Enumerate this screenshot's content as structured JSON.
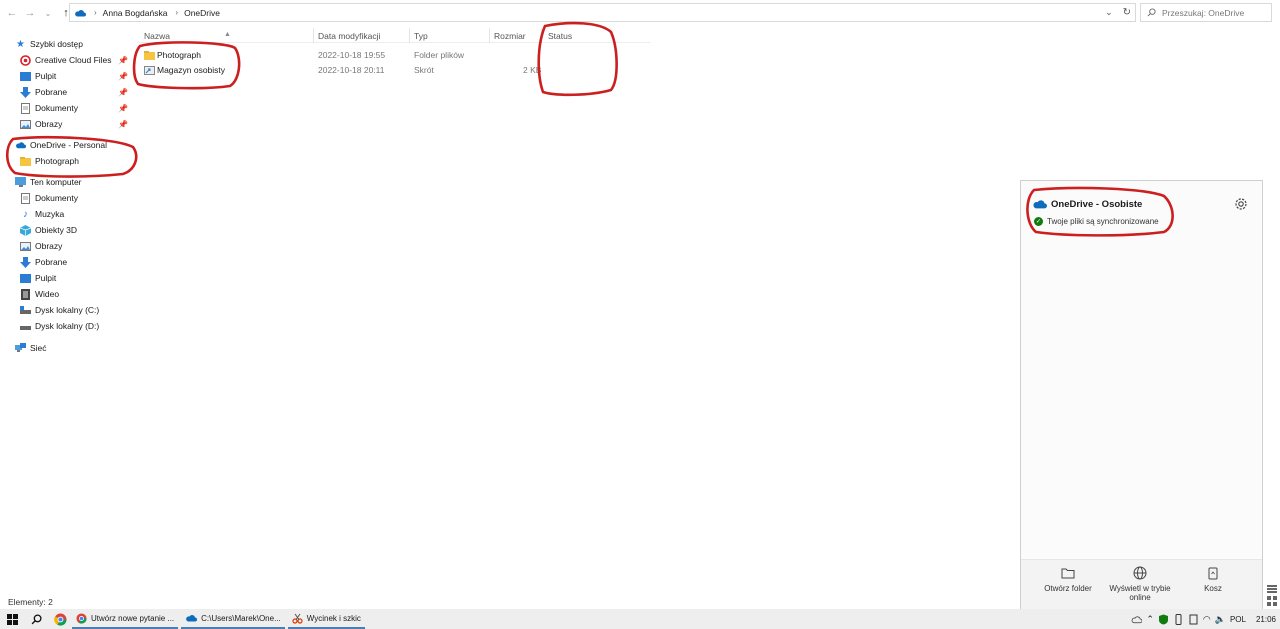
{
  "address_bar": {
    "breadcrumbs": [
      "Anna Bogdańska",
      "OneDrive"
    ]
  },
  "search": {
    "placeholder": "Przeszukaj: OneDrive"
  },
  "nav_pane": {
    "quick_access": {
      "label": "Szybki dostęp",
      "items": [
        {
          "label": "Creative Cloud Files",
          "icon": "creative-cloud-icon",
          "pinned": true
        },
        {
          "label": "Pulpit",
          "icon": "desktop-icon",
          "pinned": true
        },
        {
          "label": "Pobrane",
          "icon": "download-icon",
          "pinned": true
        },
        {
          "label": "Dokumenty",
          "icon": "document-icon",
          "pinned": true
        },
        {
          "label": "Obrazy",
          "icon": "pictures-icon",
          "pinned": true
        }
      ]
    },
    "onedrive": {
      "label": "OneDrive - Personal",
      "items": [
        {
          "label": "Photograph",
          "icon": "folder-icon"
        }
      ]
    },
    "this_pc": {
      "label": "Ten komputer",
      "items": [
        {
          "label": "Dokumenty",
          "icon": "document-icon"
        },
        {
          "label": "Muzyka",
          "icon": "music-icon"
        },
        {
          "label": "Obiekty 3D",
          "icon": "objects-3d-icon"
        },
        {
          "label": "Obrazy",
          "icon": "pictures-icon"
        },
        {
          "label": "Pobrane",
          "icon": "download-icon"
        },
        {
          "label": "Pulpit",
          "icon": "desktop-icon"
        },
        {
          "label": "Wideo",
          "icon": "video-icon"
        },
        {
          "label": "Dysk lokalny (C:)",
          "icon": "drive-icon"
        },
        {
          "label": "Dysk lokalny (D:)",
          "icon": "drive-icon"
        }
      ]
    },
    "network": {
      "label": "Sieć"
    }
  },
  "file_list": {
    "columns": [
      "Nazwa",
      "Data modyfikacji",
      "Typ",
      "Rozmiar",
      "Status"
    ],
    "rows": [
      {
        "name": "Photograph",
        "modified": "2022-10-18 19:55",
        "type": "Folder plików",
        "size": ""
      },
      {
        "name": "Magazyn osobisty",
        "modified": "2022-10-18 20:11",
        "type": "Skrót",
        "size": "2 KB"
      }
    ]
  },
  "status_bar": {
    "text": "Elementy: 2"
  },
  "onedrive_flyout": {
    "title": "OneDrive - Osobiste",
    "status": "Twoje pliki są synchronizowane",
    "footer": {
      "open_folder": "Otwórz folder",
      "view_online": "Wyświetl w trybie online",
      "recycle_bin": "Kosz"
    }
  },
  "taskbar": {
    "apps": [
      {
        "label": "Utwórz nowe pytanie ...",
        "icon": "chrome-icon"
      },
      {
        "label": "C:\\Users\\Marek\\One...",
        "icon": "onedrive-icon"
      },
      {
        "label": "Wycinek i szkic",
        "icon": "snip-sketch-icon"
      }
    ],
    "tray": {
      "language": "POL",
      "time": "21:06"
    }
  },
  "colors": {
    "annotation": "#cc1f1f",
    "onedrive_blue": "#0f6cbd",
    "sync_green": "#107c10",
    "folder_yellow": "#f5c542"
  }
}
